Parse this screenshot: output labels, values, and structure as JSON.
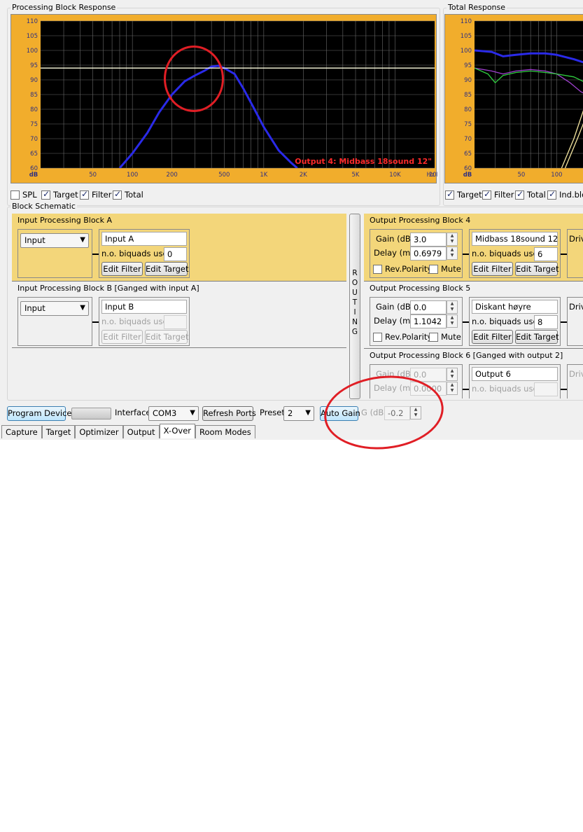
{
  "panels": {
    "processing_title": "Processing Block Response",
    "total_title": "Total Response",
    "schematic_title": "Block Schematic"
  },
  "chart_data": [
    {
      "type": "line",
      "title": "Processing Block Response",
      "ylabel": "dB",
      "xlabel": "Hz",
      "xscale": "log",
      "xlim": [
        20,
        20000
      ],
      "ylim": [
        60,
        110
      ],
      "yticks": [
        60,
        65,
        70,
        75,
        80,
        85,
        90,
        95,
        100,
        105,
        110
      ],
      "xticks": [
        "50",
        "100",
        "200",
        "500",
        "1K",
        "2K",
        "5K",
        "10K",
        "20K"
      ],
      "xtick_values": [
        50,
        100,
        200,
        500,
        1000,
        2000,
        5000,
        10000,
        20000
      ],
      "annotation": "Output 4: Midbass 18sound 12\"",
      "reference_level": 94,
      "series": [
        {
          "color": "#2a2ae8",
          "points": [
            [
              80,
              60
            ],
            [
              100,
              65
            ],
            [
              130,
              72
            ],
            [
              160,
              79
            ],
            [
              200,
              85
            ],
            [
              250,
              89.5
            ],
            [
              300,
              91.5
            ],
            [
              350,
              93
            ],
            [
              400,
              94.5
            ],
            [
              450,
              94.8
            ],
            [
              500,
              94
            ],
            [
              600,
              92
            ],
            [
              700,
              87
            ],
            [
              850,
              80
            ],
            [
              1000,
              74
            ],
            [
              1300,
              66
            ],
            [
              1600,
              62
            ],
            [
              1800,
              60
            ]
          ]
        },
        {
          "color": "#ffffe0",
          "points": [
            [
              20,
              94
            ],
            [
              20000,
              94
            ]
          ]
        }
      ]
    },
    {
      "type": "line",
      "title": "Total Response",
      "ylabel": "dB",
      "xscale": "log",
      "xlim": [
        20,
        200
      ],
      "ylim": [
        60,
        110
      ],
      "yticks": [
        60,
        65,
        70,
        75,
        80,
        85,
        90,
        95,
        100,
        105,
        110
      ],
      "xticks": [
        "50",
        "100"
      ],
      "xtick_values": [
        50,
        100
      ],
      "series": [
        {
          "color": "#2a2ae8",
          "points": [
            [
              20,
              100
            ],
            [
              28,
              99.5
            ],
            [
              35,
              98
            ],
            [
              45,
              98.5
            ],
            [
              60,
              99
            ],
            [
              80,
              99
            ],
            [
              100,
              98.5
            ],
            [
              140,
              97
            ],
            [
              200,
              95
            ]
          ]
        },
        {
          "color": "#a040d0",
          "points": [
            [
              20,
              94
            ],
            [
              28,
              93
            ],
            [
              35,
              92
            ],
            [
              45,
              93
            ],
            [
              60,
              93.5
            ],
            [
              80,
              93
            ],
            [
              100,
              92
            ],
            [
              130,
              89
            ],
            [
              160,
              86
            ],
            [
              200,
              84
            ]
          ]
        },
        {
          "color": "#30d040",
          "points": [
            [
              20,
              94
            ],
            [
              26,
              92
            ],
            [
              30,
              89
            ],
            [
              35,
              91.5
            ],
            [
              45,
              92.5
            ],
            [
              60,
              93
            ],
            [
              80,
              92.5
            ],
            [
              100,
              92
            ],
            [
              140,
              91
            ],
            [
              200,
              88
            ]
          ]
        },
        {
          "color": "#f5e6a0",
          "points": [
            [
              110,
              60
            ],
            [
              140,
              70
            ],
            [
              170,
              80
            ],
            [
              200,
              87
            ]
          ]
        },
        {
          "color": "#f5e6a0",
          "points": [
            [
              118,
              60
            ],
            [
              150,
              70
            ],
            [
              180,
              78
            ],
            [
              200,
              83
            ]
          ]
        }
      ]
    }
  ],
  "left_checks": [
    {
      "label": "SPL",
      "checked": false
    },
    {
      "label": "Target",
      "checked": true
    },
    {
      "label": "Filter",
      "checked": true
    },
    {
      "label": "Total",
      "checked": true
    }
  ],
  "right_checks": [
    {
      "label": "Target",
      "checked": true
    },
    {
      "label": "Filter",
      "checked": true
    },
    {
      "label": "Total",
      "checked": true
    },
    {
      "label": "Ind.bloc",
      "checked": true
    }
  ],
  "input_blocks": [
    {
      "title": "Input Processing Block A",
      "source": "Input",
      "name": "Input A",
      "biquads_label": "n.o. biquads used",
      "biquads": "0",
      "edit_filter": "Edit Filter",
      "edit_target": "Edit Target",
      "enabled": true
    },
    {
      "title": "Input Processing Block B [Ganged with input A]",
      "source": "Input",
      "name": "Input B",
      "biquads_label": "n.o. biquads used",
      "biquads": "",
      "edit_filter": "Edit Filter",
      "edit_target": "Edit Target",
      "enabled": false
    }
  ],
  "routing_letters": [
    "R",
    "O",
    "U",
    "T",
    "I",
    "N",
    "G"
  ],
  "output_blocks": [
    {
      "title": "Output Processing Block 4",
      "gain_label": "Gain (dB)",
      "gain": "3.0",
      "delay_label": "Delay (ms)",
      "delay": "0.6979",
      "rev_polarity": "Rev.Polarity",
      "mute": "Mute",
      "name": "Midbass 18sound 12\"",
      "biquads_label": "n.o. biquads used",
      "biquads": "6",
      "edit_filter": "Edit Filter",
      "edit_target": "Edit Target",
      "driver": "Driv",
      "enabled": true
    },
    {
      "title": "Output Processing Block 5",
      "gain_label": "Gain (dB)",
      "gain": "0.0",
      "delay_label": "Delay (ms)",
      "delay": "1.1042",
      "rev_polarity": "Rev.Polarity",
      "mute": "Mute",
      "name": "Diskant høyre",
      "biquads_label": "n.o. biquads used",
      "biquads": "8",
      "edit_filter": "Edit Filter",
      "edit_target": "Edit Target",
      "driver": "Driv",
      "enabled": true
    },
    {
      "title": "Output Processing Block 6 [Ganged with output 2]",
      "gain_label": "Gain (dB)",
      "gain": "0.0",
      "delay_label": "Delay (ms)",
      "delay": "0.0000",
      "name": "Output 6",
      "biquads_label": "n.o. biquads used",
      "biquads": "",
      "driver": "Driv",
      "enabled": false
    }
  ],
  "toolbar": {
    "program_device": "Program Device",
    "interface_label": "Interface",
    "interface_value": "COM3",
    "refresh_ports": "Refresh Ports",
    "preset_label": "Preset",
    "preset_value": "2",
    "auto_gain": "Auto Gain",
    "gain_label": "G (dB)",
    "gain_value": "-0.2"
  },
  "tabs": [
    "Capture",
    "Target",
    "Optimizer",
    "Output",
    "X-Over",
    "Room Modes"
  ],
  "active_tab": "X-Over",
  "colors": {
    "chart_frame": "#f1ad2c",
    "plot_bg": "#000000",
    "grid": "#6b6b6b",
    "annotation_text": "#ff2a2a",
    "highlight_circle": "#e01e25",
    "active_block": "#f3d67a"
  }
}
